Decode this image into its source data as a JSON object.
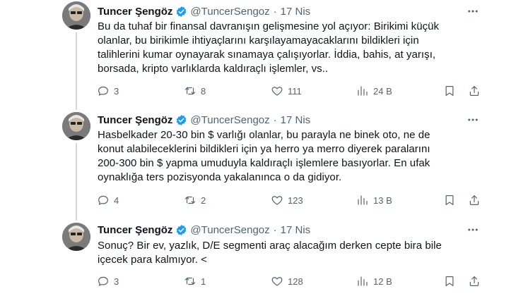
{
  "author": {
    "name": "Tuncer Şengöz",
    "handle": "@TuncerSengoz",
    "separator": "·"
  },
  "tweets": [
    {
      "date": "17 Nis",
      "text": "Bu da tuhaf bir finansal davranışın gelişmesine yol açıyor: Birikimi küçük\nolanlar, bu birikimle ihtiyaçlarını karşılayamayacaklarını bildikleri için\ntalihlerini kumar oynayarak sınamaya çalışıyorlar. İddia, bahis, at yarışı,\nborsada, kripto varlıklarda kaldıraçlı işlemler, vs..",
      "replies": "3",
      "retweets": "8",
      "likes": "111",
      "views": "24 B"
    },
    {
      "date": "17 Nis",
      "text": "Hasbelkader 20-30 bin $ varlığı olanlar, bu parayla ne binek oto, ne de\nkonut alabileceklerini bildikleri için ya herro ya merro diyerek paralarını\n200-300 bin $ yapma umuduyla kaldıraçlı işlemlere basıyorlar. En ufak\noynaklığa ters pozisyonda yakalanınca o da gidiyor.",
      "replies": "4",
      "retweets": "2",
      "likes": "123",
      "views": "13 B"
    },
    {
      "date": "17 Nis",
      "text": "Sonuç? Bir ev, yazlık, D/E segmenti araç alacağım derken cepte bira bile\niçecek para kalmıyor. <",
      "replies": "3",
      "retweets": "1",
      "likes": "128",
      "views": "12 B"
    }
  ],
  "colors": {
    "text": "#0f1419",
    "secondary": "#536471",
    "verified": "#1d9bf0",
    "thread_line": "#cfd9de"
  }
}
